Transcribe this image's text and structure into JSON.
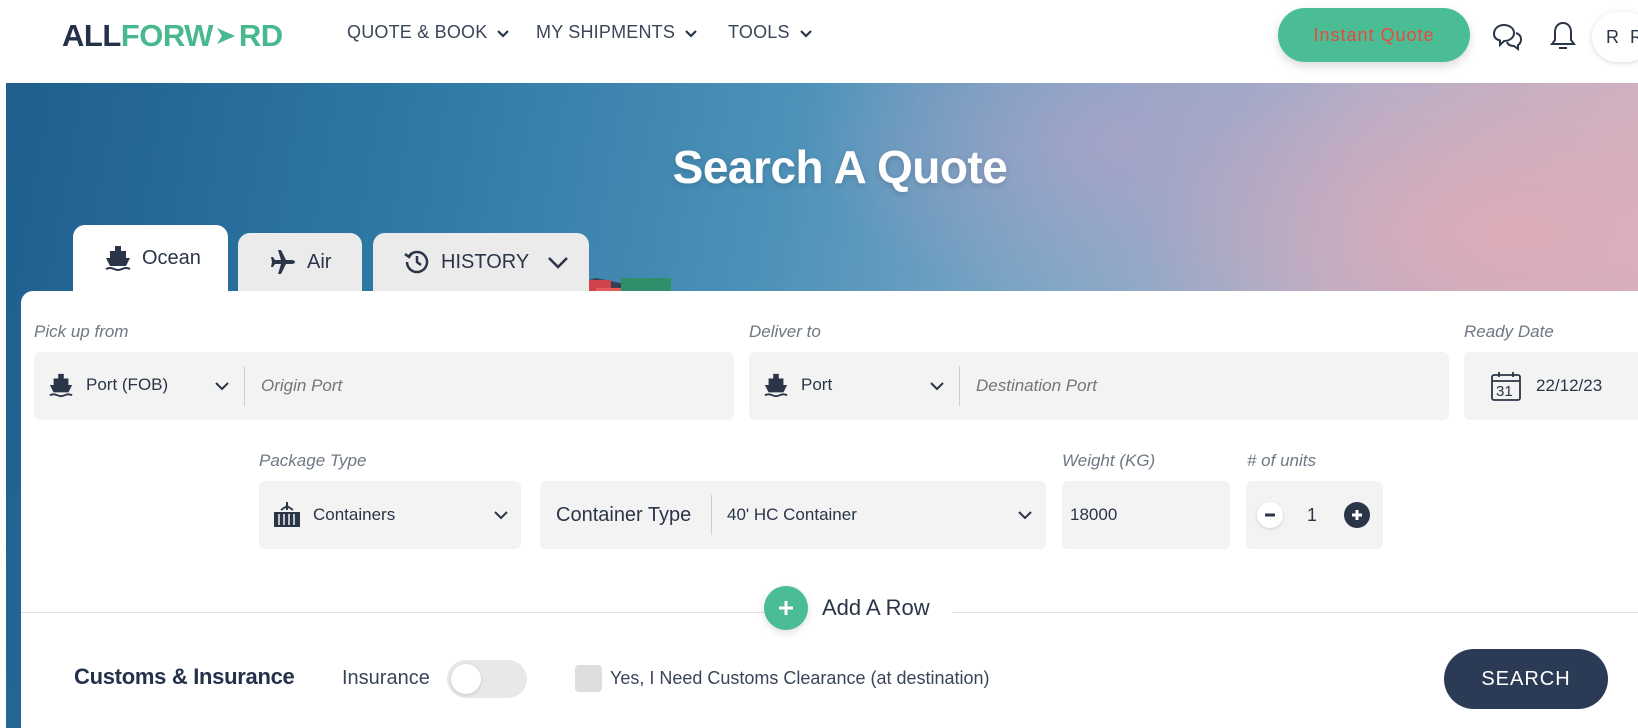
{
  "brand": {
    "logo_part1": "ALL",
    "logo_part2": "FORW",
    "logo_part3": "RD"
  },
  "nav": {
    "items": [
      {
        "label": "QUOTE & BOOK"
      },
      {
        "label": "MY SHIPMENTS"
      },
      {
        "label": "TOOLS"
      }
    ],
    "instant_quote": "Instant Quote",
    "avatar_initials": "R R"
  },
  "hero": {
    "title": "Search A Quote"
  },
  "tabs": [
    {
      "label": "Ocean",
      "icon": "ship-icon",
      "active": true
    },
    {
      "label": "Air",
      "icon": "plane-icon",
      "active": false
    },
    {
      "label": "HISTORY",
      "icon": "history-icon",
      "active": false
    }
  ],
  "form": {
    "pickup": {
      "label": "Pick up from",
      "type": "Port (FOB)",
      "placeholder": "Origin Port"
    },
    "deliver": {
      "label": "Deliver to",
      "type": "Port",
      "placeholder": "Destination Port"
    },
    "ready_date": {
      "label": "Ready Date",
      "value": "22/12/23",
      "calendar_day": "31"
    },
    "package": {
      "label": "Package Type",
      "value": "Containers"
    },
    "container": {
      "label": "Container Type",
      "value": "40' HC Container"
    },
    "weight": {
      "label": "Weight (KG)",
      "value": "18000"
    },
    "units": {
      "label": "# of units",
      "value": "1"
    },
    "add_row": "Add A Row"
  },
  "footer": {
    "title": "Customs & Insurance",
    "insurance_label": "Insurance",
    "insurance_on": false,
    "customs_label": "Yes, I Need Customs Clearance (at destination)",
    "customs_checked": false,
    "search_label": "SEARCH"
  },
  "colors": {
    "accent": "#4bbd95",
    "navy": "#2b3a55",
    "quote_text": "#e8483d"
  }
}
